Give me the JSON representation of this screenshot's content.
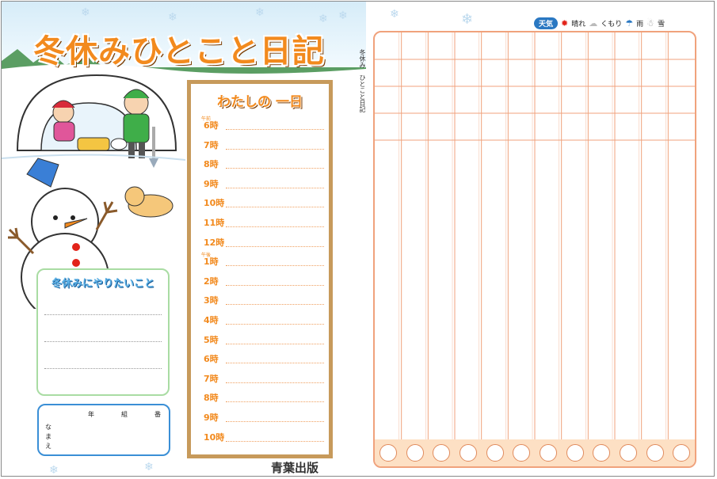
{
  "header": {
    "title": "冬休みひとこと日記",
    "side_label_1": "冬休み",
    "side_label_2": "ひとこと日記"
  },
  "weather": {
    "tag": "天気",
    "items": [
      {
        "icon": "sun-icon",
        "label": "晴れ"
      },
      {
        "icon": "cloud-icon",
        "label": "くもり"
      },
      {
        "icon": "umbrella-icon",
        "label": "雨"
      },
      {
        "icon": "snowman-icon",
        "label": "雪"
      }
    ]
  },
  "schedule": {
    "title": "わたしの 一日",
    "am_label": "午前",
    "pm_label": "午後",
    "hours": [
      "6時",
      "7時",
      "8時",
      "9時",
      "10時",
      "11時",
      "12時",
      "1時",
      "2時",
      "3時",
      "4時",
      "5時",
      "6時",
      "7時",
      "8時",
      "9時",
      "10時"
    ]
  },
  "wish": {
    "title": "冬休みにやりたいこと"
  },
  "name_box": {
    "year": "年",
    "class": "組",
    "number": "番",
    "name_1": "な",
    "name_2": "ま",
    "name_3": "え"
  },
  "footer": {
    "publisher": "青葉出版"
  },
  "colors": {
    "accent_orange": "#f28a1e",
    "grid_line": "#f0a27c",
    "box_brown": "#c79a5b",
    "wish_green": "#a9dca3",
    "name_blue": "#3a8fd6"
  }
}
